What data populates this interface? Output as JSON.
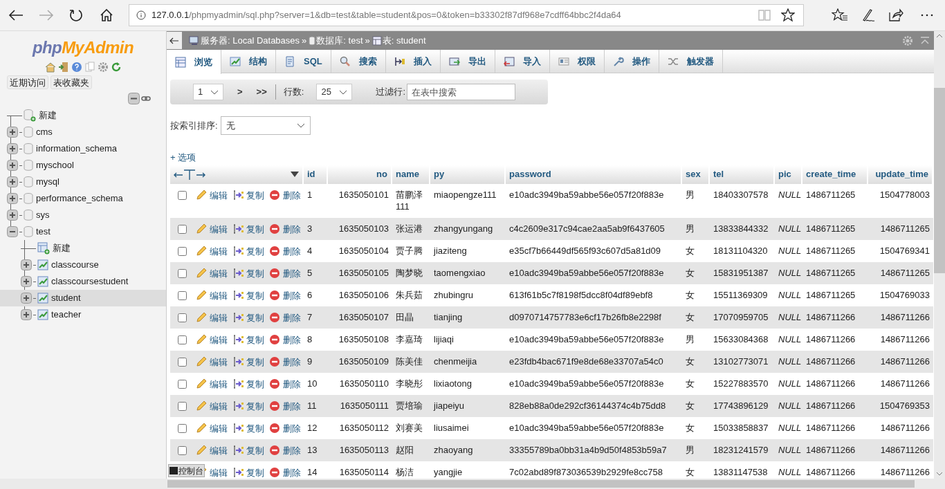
{
  "browser": {
    "url_host": "127.0.0.1",
    "url_path": "/phpmyadmin/sql.php?server=1&db=test&table=student&pos=0&token=b33302f87df968e7cdff64bbc2f4da64"
  },
  "sidebar": {
    "logo": {
      "php": "php",
      "myadmin": "MyAdmin"
    },
    "buttons": [
      "近期访问",
      "表收藏夹"
    ],
    "tree": [
      {
        "label": "新建",
        "kind": "new",
        "selected": false
      },
      {
        "label": "cms",
        "kind": "db",
        "expanded": false,
        "selected": false
      },
      {
        "label": "information_schema",
        "kind": "db",
        "expanded": false,
        "selected": false
      },
      {
        "label": "myschool",
        "kind": "db",
        "expanded": false,
        "selected": false
      },
      {
        "label": "mysql",
        "kind": "db",
        "expanded": false,
        "selected": false
      },
      {
        "label": "performance_schema",
        "kind": "db",
        "expanded": false,
        "selected": false
      },
      {
        "label": "sys",
        "kind": "db",
        "expanded": false,
        "selected": false
      },
      {
        "label": "test",
        "kind": "db",
        "expanded": true,
        "selected": false,
        "children": [
          {
            "label": "新建",
            "kind": "new",
            "selected": false
          },
          {
            "label": "classcourse",
            "kind": "table",
            "expanded": false,
            "selected": false
          },
          {
            "label": "classcoursestudent",
            "kind": "table",
            "expanded": false,
            "selected": false
          },
          {
            "label": "student",
            "kind": "table",
            "expanded": false,
            "selected": true
          },
          {
            "label": "teacher",
            "kind": "table",
            "expanded": false,
            "selected": false
          }
        ]
      }
    ]
  },
  "breadcrumb": {
    "separator": "»",
    "items": [
      "服务器: Local Databases",
      "数据库: test",
      "表: student"
    ]
  },
  "tabs": [
    {
      "label": "浏览",
      "selected": true
    },
    {
      "label": "结构",
      "selected": false
    },
    {
      "label": "SQL",
      "selected": false
    },
    {
      "label": "搜索",
      "selected": false
    },
    {
      "label": "插入",
      "selected": false
    },
    {
      "label": "导出",
      "selected": false
    },
    {
      "label": "导入",
      "selected": false
    },
    {
      "label": "权限",
      "selected": false
    },
    {
      "label": "操作",
      "selected": false
    },
    {
      "label": "触发器",
      "selected": false
    }
  ],
  "pager": {
    "page": "1",
    "next": ">",
    "last": ">>",
    "rows_label": "行数:",
    "rows_value": "25",
    "filter_label": "过滤行:",
    "filter_placeholder": "在表中搜索"
  },
  "sort": {
    "label": "按索引排序:",
    "value": "无"
  },
  "options_link": "+ 选项",
  "table": {
    "columns": [
      "id",
      "no",
      "name",
      "py",
      "password",
      "sex",
      "tel",
      "pic",
      "create_time",
      "update_time"
    ],
    "rows": [
      {
        "checked": false,
        "actions": [
          "编辑",
          "复制",
          "删除"
        ],
        "cells": [
          "1",
          "1635050101",
          "苗鹏泽111",
          "miaopengze111",
          "e10adc3949ba59abbe56e057f20f883e",
          "男",
          "18403307578",
          {
            "text": "NULL",
            "null": true
          },
          "1486711265",
          "1504778003"
        ]
      },
      {
        "checked": false,
        "actions": [
          "编辑",
          "复制",
          "删除"
        ],
        "cells": [
          "3",
          "1635050103",
          "张运港",
          "zhangyungang",
          "c4c2609e317c94cae2aa5ab9f6437605",
          "男",
          "13833844332",
          {
            "text": "NULL",
            "null": true
          },
          "1486711265",
          "1486711265"
        ]
      },
      {
        "checked": false,
        "actions": [
          "编辑",
          "复制",
          "删除"
        ],
        "cells": [
          "4",
          "1635050104",
          "贾子腾",
          "jiaziteng",
          "e35cf7b66449df565f93c607d5a81d09",
          "女",
          "18131104320",
          {
            "text": "NULL",
            "null": true
          },
          "1486711265",
          "1504769341"
        ]
      },
      {
        "checked": false,
        "actions": [
          "编辑",
          "复制",
          "删除"
        ],
        "cells": [
          "5",
          "1635050105",
          "陶梦晓",
          "taomengxiao",
          "e10adc3949ba59abbe56e057f20f883e",
          "女",
          "15831951387",
          {
            "text": "NULL",
            "null": true
          },
          "1486711265",
          "1486711265"
        ]
      },
      {
        "checked": false,
        "actions": [
          "编辑",
          "复制",
          "删除"
        ],
        "cells": [
          "6",
          "1635050106",
          "朱兵茹",
          "zhubingru",
          "613f61b5c7f8198f5dcc8f04df89ebf8",
          "女",
          "15511369309",
          {
            "text": "NULL",
            "null": true
          },
          "1486711265",
          "1504769033"
        ]
      },
      {
        "checked": false,
        "actions": [
          "编辑",
          "复制",
          "删除"
        ],
        "cells": [
          "7",
          "1635050107",
          "田晶",
          "tianjing",
          "d0970714757783e6cf17b26fb8e2298f",
          "女",
          "17070959705",
          {
            "text": "NULL",
            "null": true
          },
          "1486711266",
          "1486711266"
        ]
      },
      {
        "checked": false,
        "actions": [
          "编辑",
          "复制",
          "删除"
        ],
        "cells": [
          "8",
          "1635050108",
          "李嘉琦",
          "lijiaqi",
          "e10adc3949ba59abbe56e057f20f883e",
          "男",
          "15633084368",
          {
            "text": "NULL",
            "null": true
          },
          "1486711266",
          "1486711266"
        ]
      },
      {
        "checked": false,
        "actions": [
          "编辑",
          "复制",
          "删除"
        ],
        "cells": [
          "9",
          "1635050109",
          "陈美佳",
          "chenmeijia",
          "e23fdb4bac671f9e8de68e33707a54c0",
          "女",
          "13102773071",
          {
            "text": "NULL",
            "null": true
          },
          "1486711266",
          "1486711266"
        ]
      },
      {
        "checked": false,
        "actions": [
          "编辑",
          "复制",
          "删除"
        ],
        "cells": [
          "10",
          "1635050110",
          "李晓彤",
          "lixiaotong",
          "e10adc3949ba59abbe56e057f20f883e",
          "女",
          "15227883570",
          {
            "text": "NULL",
            "null": true
          },
          "1486711266",
          "1486711266"
        ]
      },
      {
        "checked": false,
        "actions": [
          "编辑",
          "复制",
          "删除"
        ],
        "cells": [
          "11",
          "1635050111",
          "贾培瑜",
          "jiapeiyu",
          "828eb88a0de292cf36144374c4b75dd8",
          "女",
          "17743896129",
          {
            "text": "NULL",
            "null": true
          },
          "1486711266",
          "1504769353"
        ]
      },
      {
        "checked": false,
        "actions": [
          "编辑",
          "复制",
          "删除"
        ],
        "cells": [
          "12",
          "1635050112",
          "刘赛美",
          "liusaimei",
          "e10adc3949ba59abbe56e057f20f883e",
          "女",
          "15033858837",
          {
            "text": "NULL",
            "null": true
          },
          "1486711266",
          "1486711266"
        ]
      },
      {
        "checked": false,
        "actions": [
          "编辑",
          "复制",
          "删除"
        ],
        "cells": [
          "13",
          "1635050113",
          "赵阳",
          "zhaoyang",
          "33355789ba0bb31a4b9d50f4853b59a7",
          "男",
          "18231241579",
          {
            "text": "NULL",
            "null": true
          },
          "1486711266",
          "1486711266"
        ]
      },
      {
        "actions": [
          "编辑",
          "复制",
          "删除"
        ],
        "cells": [
          "14",
          "1635050114",
          "杨洁",
          "yangjie",
          "7c02abd89f873036539b2929fe8cc758",
          "女",
          "13831147538",
          {
            "text": "NULL",
            "null": true
          },
          "1486711266",
          "1486711266"
        ]
      }
    ]
  },
  "console_button": "控制台"
}
